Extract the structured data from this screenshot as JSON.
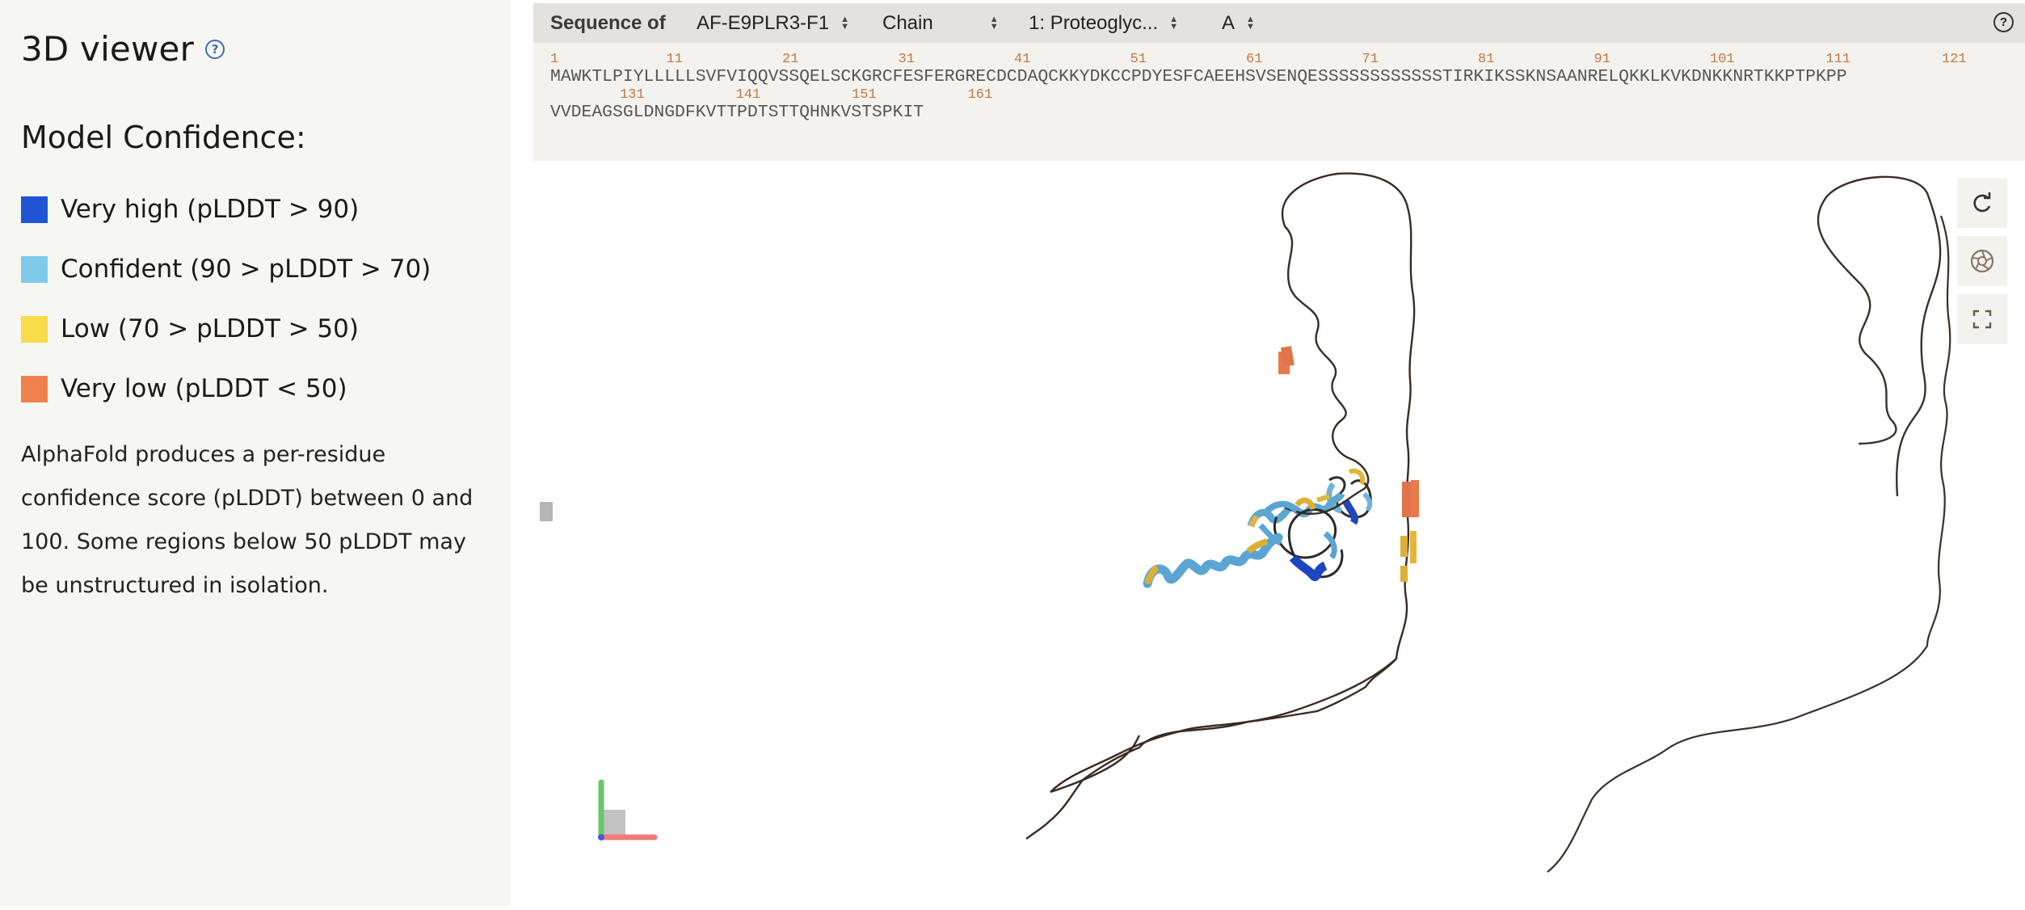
{
  "left": {
    "title": "3D viewer",
    "help_icon_text": "?",
    "confidence_title": "Model Confidence:",
    "legend": [
      {
        "label": "Very high (pLDDT > 90)",
        "color": "#1f55d5"
      },
      {
        "label": "Confident (90 > pLDDT > 70)",
        "color": "#80cae9"
      },
      {
        "label": "Low (70 > pLDDT > 50)",
        "color": "#fadb4c"
      },
      {
        "label": "Very low (pLDDT < 50)",
        "color": "#f0834d"
      }
    ],
    "description": "AlphaFold produces a per-residue confidence score (pLDDT) between 0 and 100. Some regions below 50 pLDDT may be unstructured in isolation."
  },
  "sequence": {
    "label": "Sequence of",
    "model_select": "AF-E9PLR3-F1",
    "chain_type_select": "Chain",
    "entity_select": "1: Proteoglyc...",
    "chain_select": "A",
    "help_icon_text": "?",
    "lines": [
      {
        "numbers": [
          "1",
          "11",
          "21",
          "31",
          "41",
          "51",
          "61",
          "71",
          "81",
          "91",
          "101",
          "111",
          "121"
        ],
        "residues": "MAWKTLPIYLLLLLSVFVIQQVSSQELSCKGRCFESFERGRECDCDAQCKKYDKCCPDYESFCAEEHSVSENQESSSSSSSSSSSSTIRKIKSSKNSAANRELQKKLKVKDNKKNRTKKPTPKPP"
      },
      {
        "numbers": [
          "131",
          "141",
          "151",
          "161"
        ],
        "residues": "VVDEAGSGLDNGDFKVTTPDTSTTQHNKVSTSPKIT"
      }
    ]
  },
  "viewer": {
    "controls": [
      {
        "name": "reset-view",
        "icon": "refresh-icon"
      },
      {
        "name": "screenshot",
        "icon": "camera-aperture-icon"
      },
      {
        "name": "fullscreen",
        "icon": "expand-icon"
      }
    ],
    "axis_colors": {
      "x": "#f07b7b",
      "y": "#6bc76b",
      "z": "#4a57d8"
    }
  }
}
